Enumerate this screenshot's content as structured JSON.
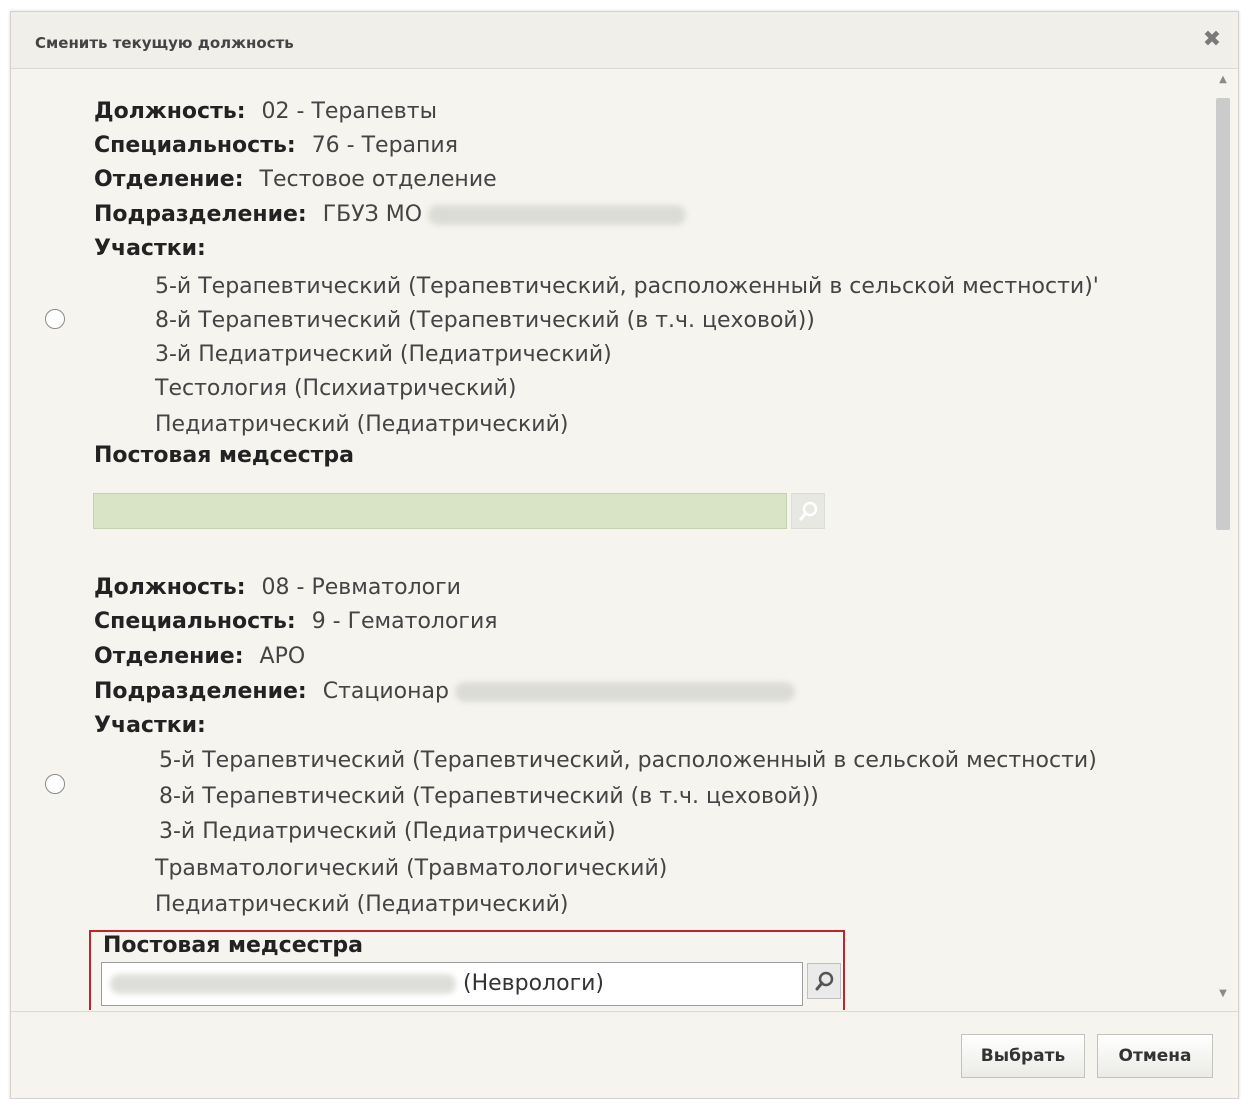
{
  "dialog": {
    "title": "Сменить текущую должность",
    "close_glyph": "✖",
    "close_icon": "close-icon"
  },
  "positions": [
    {
      "position_label": "Должность:",
      "position_value": "02 - Терапевты",
      "specialty_label": "Специальность:",
      "specialty_value": "76 - Терапия",
      "department_label": "Отделение:",
      "department_value": "Тестовое отделение",
      "subdivision_label": "Подразделение:",
      "subdivision_value": "ГБУЗ МО",
      "areas_label": "Участки:",
      "areas": [
        "5-й Терапевтический (Терапевтический, расположенный в сельской местности)'",
        "8-й Терапевтический (Терапевтический (в т.ч. цеховой))",
        "3-й Педиатрический (Педиатрический)",
        "Тестология (Психиатрический)",
        "Педиатрический (Педиатрический)"
      ],
      "nurse_label": "Постовая медсестра",
      "nurse_value": "",
      "selected": false
    },
    {
      "position_label": "Должность:",
      "position_value": "08 - Ревматологи",
      "specialty_label": "Специальность:",
      "specialty_value": "9 - Гематология",
      "department_label": "Отделение:",
      "department_value": "АРО",
      "subdivision_label": "Подразделение:",
      "subdivision_value": "Стационар",
      "areas_label": "Участки:",
      "areas": [
        "5-й Терапевтический (Терапевтический, расположенный в сельской местности)",
        "8-й Терапевтический (Терапевтический (в т.ч. цеховой))",
        "3-й Педиатрический (Педиатрический)",
        "Травматологический (Травматологический)",
        "Педиатрический (Педиатрический)"
      ],
      "nurse_label": "Постовая медсестра",
      "nurse_value": "(Неврологи)",
      "selected": false
    }
  ],
  "buttons": {
    "select": "Выбрать",
    "cancel": "Отмена"
  },
  "colors": {
    "highlight_border": "#c0242b",
    "disabled_input": "#d9e4c6",
    "dialog_bg": "#f5f4ef"
  }
}
